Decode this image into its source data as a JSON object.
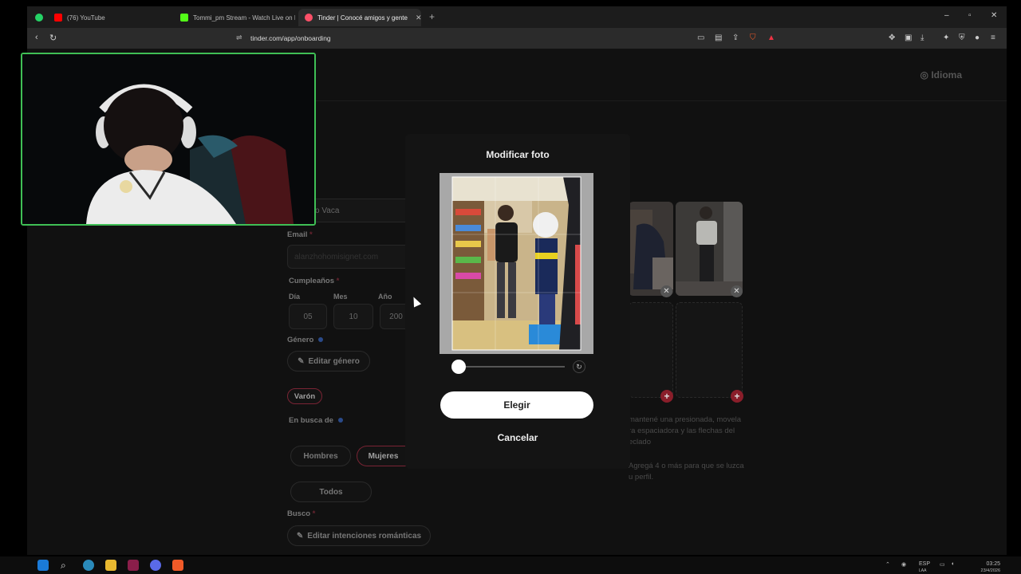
{
  "browser": {
    "tabs": [
      {
        "label": "(76) YouTube",
        "color": "#ff0000",
        "active": false
      },
      {
        "label": "Tommi_pm Stream - Watch Live on K",
        "color": "#53fc18",
        "active": false
      },
      {
        "label": "Tinder | Conocé amigos y gente",
        "color": "#fd5068",
        "active": true
      }
    ],
    "url": "tinder.com/app/onboarding"
  },
  "page": {
    "idioma": "Idioma",
    "name_value": "o Vaca",
    "email_label": "Email",
    "email_value": "alanzhohomisignet.com",
    "birthday_label": "Cumpleaños",
    "day_label": "Día",
    "month_label": "Mes",
    "year_label": "Año",
    "day_value": "05",
    "month_value": "10",
    "year_value": "200",
    "gender_label": "Género",
    "edit_gender": "Editar género",
    "gender_value": "Varón",
    "looking_for_label": "En busca de",
    "option_men": "Hombres",
    "option_women": "Mujeres",
    "option_all": "Todos",
    "seeking_label": "Busco",
    "edit_intentions": "Editar intenciones románticas",
    "hint_line1": "mantené una presionada, movela",
    "hint_line2": "ra espaciadora y las flechas del",
    "hint_line3": "eclado",
    "hint2_line1": "Agregá 4 o más para que se luzca",
    "hint2_line2": "u perfil."
  },
  "modal": {
    "title": "Modificar foto",
    "choose_button": "Elegir",
    "cancel_button": "Cancelar",
    "zoom_level": 0
  },
  "taskbar": {
    "lang": "ESP",
    "lang_sub": "LAA",
    "time": "03:25",
    "date": "23/4/2026"
  },
  "colors": {
    "accent": "#fd5068",
    "webcam_border": "#3fbf55"
  }
}
